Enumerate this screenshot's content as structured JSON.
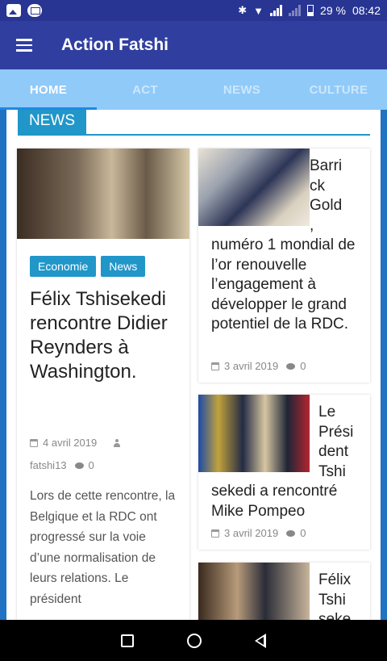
{
  "status_bar": {
    "battery": "29 %",
    "time": "08:42",
    "icons": [
      "image-icon",
      "mail-icon",
      "bluetooth-icon",
      "wifi-icon",
      "signal-icon",
      "signal-icon",
      "battery-icon"
    ]
  },
  "app_bar": {
    "title": "Action Fatshi",
    "menu_icon": "hamburger-menu-icon"
  },
  "tabs": [
    {
      "label": "HOME",
      "active": true
    },
    {
      "label": "ACT",
      "active": false
    },
    {
      "label": "NEWS",
      "active": false
    },
    {
      "label": "CULTURE",
      "active": false
    }
  ],
  "section": {
    "label": "NEWS"
  },
  "featured": {
    "categories": [
      "Economie",
      "News"
    ],
    "title": "Félix Tshisekedi rencontre Didier Reynders à Washington.",
    "date": "4 avril 2019",
    "author": "fatshi13",
    "comments": "0",
    "excerpt": "Lors de cette rencontre, la Belgique et la RDC ont progressé sur la voie d’une normalisation de leurs relations. Le président"
  },
  "articles": [
    {
      "title_lines": [
        "Barri",
        "ck",
        "Gold",
        ","
      ],
      "title_rest": "numéro 1 mondial de l’or renouvelle l’engagement à développer le grand potentiel de la RDC.",
      "date": "3 avril 2019",
      "comments": "0"
    },
    {
      "title_lines": [
        "Le",
        "Prési",
        "dent",
        "Tshi"
      ],
      "title_rest": "sekedi a rencontré Mike Pompeo",
      "date": "3 avril 2019",
      "comments": "0"
    },
    {
      "title_lines": [
        "Félix",
        "Tshi",
        "seke"
      ],
      "title_rest": "",
      "date": "",
      "comments": ""
    }
  ],
  "colors": {
    "status_bar": "#283593",
    "app_bar": "#303f9f",
    "tabs": "#90caf9",
    "accent": "#2196c8",
    "content_bg": "#1f73c2"
  },
  "nav_bar": {
    "icons": [
      "recents-square-icon",
      "home-circle-icon",
      "back-triangle-icon"
    ]
  }
}
